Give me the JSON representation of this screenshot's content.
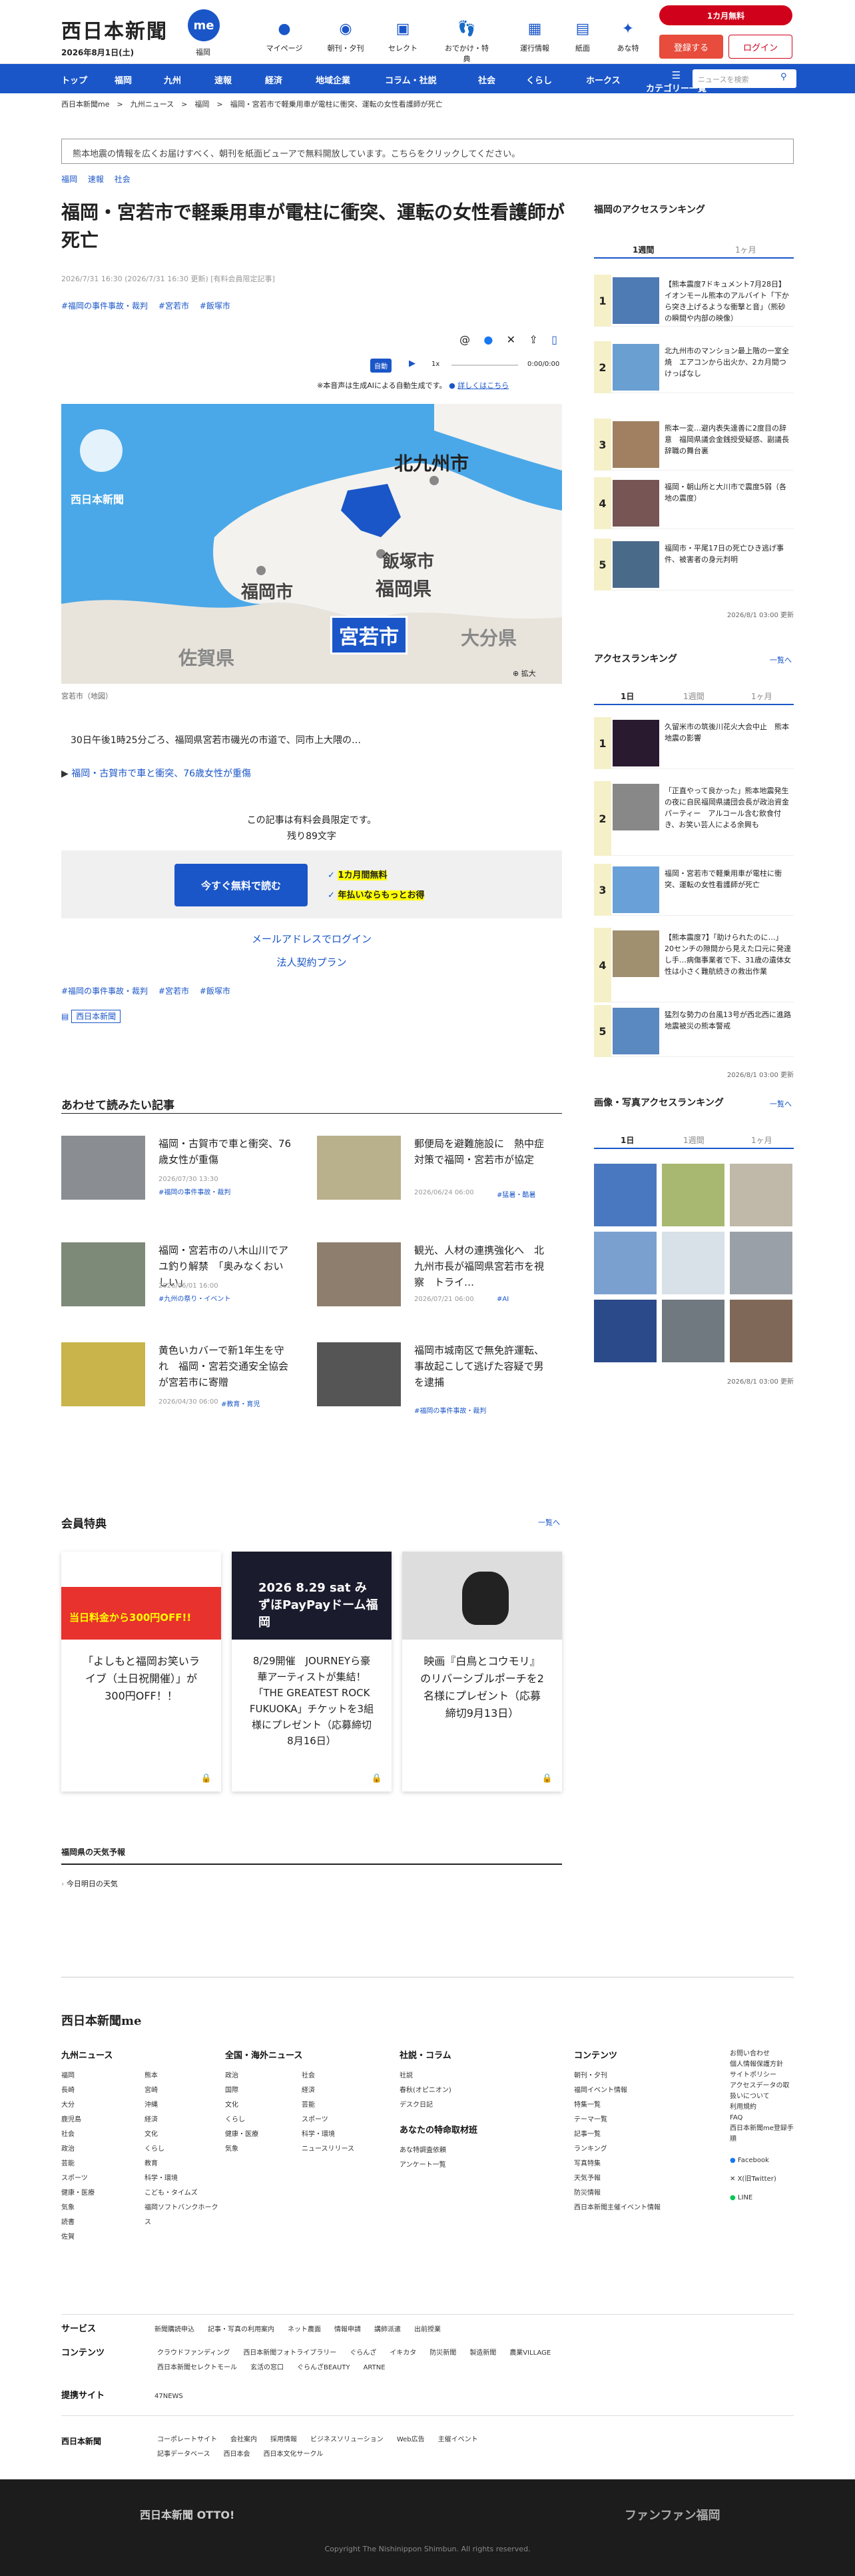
{
  "header": {
    "logo": "西日本新聞",
    "date": "2026年8月1日(土)",
    "me_label": "福岡",
    "me_logo": "me",
    "icons": [
      {
        "label": "マイページ",
        "icon": "me-icon"
      },
      {
        "label": "朝刊・夕刊",
        "icon": "newspaper-icon"
      },
      {
        "label": "セレクト",
        "icon": "select-icon"
      },
      {
        "label": "おでかけ・特典",
        "icon": "footsteps-icon"
      },
      {
        "label": "運行情報",
        "icon": "train-icon"
      },
      {
        "label": "紙面",
        "icon": "paper-icon"
      },
      {
        "label": "あな特",
        "icon": "bee-icon"
      }
    ],
    "promo": "1カ月無料",
    "register": "登録する",
    "login": "ログイン"
  },
  "nav": {
    "items": [
      "トップ",
      "福岡",
      "九州",
      "速報",
      "経済",
      "地域企業",
      "コラム・社説",
      "社会",
      "くらし",
      "ホークス"
    ],
    "more": "カテゴリー一覧",
    "search_placeholder": "ニュースを検索"
  },
  "breadcrumb": "西日本新聞me　>　九州ニュース　>　福岡　>　福岡・宮若市で軽乗用車が電柱に衝突、運転の女性看護師が死亡",
  "banner": "熊本地震の情報を広くお届けすべく、朝刊を紙面ビューアで無料開放しています。こちらをクリックしてください。",
  "article": {
    "tags": [
      "福岡",
      "速報",
      "社会"
    ],
    "title": "福岡・宮若市で軽乗用車が電柱に衝突、運転の女性看護師が死亡",
    "meta": "2026/7/31 16:30 (2026/7/31 16:30 更新) [有料会員限定記事]",
    "hashtags": [
      "#福岡の事件事故・裁判",
      "#宮若市",
      "#飯塚市"
    ],
    "audio": {
      "mode": "自動",
      "speed": "1x",
      "time": "0:00/0:00",
      "note": "※本音声は生成AIによる自動生成です。",
      "link": "詳しくはこちら"
    },
    "map": {
      "labels": [
        "北九州市",
        "飯塚市",
        "福岡県",
        "福岡市",
        "宮若市",
        "佐賀県",
        "大分県"
      ],
      "watermark": "西日本新聞",
      "zoom": "拡大"
    },
    "caption": "宮若市（地図）",
    "lead": "30日午後1時25分ごろ、福岡県宮若市磯光の市道で、同市上大隈の…",
    "related": "福岡・古賀市で車と衝突、76歳女性が重傷",
    "pay_line1": "この記事は有料会員限定です。",
    "pay_line2": "残り89文字",
    "read_btn": "今すぐ無料で読む",
    "check1": "1カ月間無料",
    "check2": "年払いならもっとお得",
    "link_mail": "メールアドレスでログイン",
    "link_corp": "法人契約プラン",
    "tag_box": "西日本新聞"
  },
  "recommend": {
    "title": "あわせて読みたい記事",
    "items": [
      {
        "title": "福岡・古賀市で車と衝突、76歳女性が重傷",
        "date": "2026/07/30 13:30",
        "tag": "#福岡の事件事故・裁判"
      },
      {
        "title": "郵便局を避難施設に　熱中症対策で福岡・宮若市が協定",
        "date": "2026/06/24 06:00",
        "tag": "#猛暑・酷暑"
      },
      {
        "title": "福岡・宮若市の八木山川でアユ釣り解禁　「奥みなくおいしい」",
        "date": "2026/06/01 16:00",
        "tag": "#九州の祭り・イベント"
      },
      {
        "title": "観光、人材の連携強化へ　北九州市長が福岡県宮若市を視察　トライ…",
        "date": "2026/07/21 06:00",
        "tag": "#AI"
      },
      {
        "title": "黄色いカバーで新1年生を守れ　福岡・宮若交通安全協会が宮若市に寄贈",
        "date": "2026/04/30 06:00",
        "tag": "#教育・育児"
      },
      {
        "title": "福岡市城南区で無免許運転、事故起こして逃げた容疑で男を逮捕",
        "date": "2026/06/18 12:00",
        "tag": "#福岡の事件事故・裁判"
      }
    ]
  },
  "benefits": {
    "title": "会員特典",
    "more": "一覧へ",
    "items": [
      {
        "title": "「よしもと福岡お笑いライブ（土日祝開催）」が300円OFF！！",
        "img": "当日料金から300円OFF!!"
      },
      {
        "title": "8/29開催　JOURNEYら豪華アーティストが集結！「THE GREATEST ROCK FUKUOKA」チケットを3組様にプレゼント（応募締切8月16日）",
        "img": "2026 8.29 sat みずほPayPayドーム福岡"
      },
      {
        "title": "映画『白鳥とコウモリ』のリバーシブルポーチを2名様にプレゼント（応募締切9月13日）",
        "img": ""
      }
    ]
  },
  "weather": {
    "title": "福岡県の天気予報",
    "item": "今日明日の天気"
  },
  "sidebar": {
    "access_title": "福岡のアクセスランキング",
    "tabs": [
      "1週間",
      "1ヶ月"
    ],
    "access": [
      "【熊本震度7ドキュメント7月28日】イオンモール熊本のアルバイト「下から突き上げるような衝撃と音」（熊砂の瞬間や内部の映像）",
      "北九州市のマンション最上階の一室全焼　エアコンから出火か、2カ月間つけっぱなし",
      "熊本一変…避内表失達善に2度目の辞意　福岡県議会金銭授受疑惑、副議長辞職の舞台裏",
      "福岡・朝山所と大川市で震度5弱（各地の震度）",
      "福岡市・平尾17日の死亡ひき逃げ事件、被害者の身元判明"
    ],
    "access_updated": "2026/8/1 03:00 更新",
    "ranking_title": "アクセスランキング",
    "more": "一覧へ",
    "rtabs": [
      "1日",
      "1週間",
      "1ヶ月"
    ],
    "ranking": [
      "久留米市の筑後川花火大会中止　熊本地震の影響",
      "「正直やって良かった」熊本地震発生の夜に自民福岡県議団会長が政治資金パーティー　アルコール含む飲食付き、お笑い芸人による余興も",
      "福岡・宮若市で軽乗用車が電柱に衝突、運転の女性看護師が死亡",
      "【熊本震度7】「助けられたのに…」20センチの隙間から見えた口元に発達し手…病傷事業者で下、31歳の遺体女性は小さく難航続きの救出作業",
      "猛烈な勢力の台風13号が西北西に進路　地震被災の熊本警戒"
    ],
    "ranking_updated": "2026/8/1 03:00 更新",
    "photo_title": "画像・写真アクセスランキング",
    "photo_updated": "2026/8/1 03:00 更新"
  },
  "footer": {
    "logo": "西日本新聞me",
    "kyushu": {
      "title": "九州ニュース",
      "items": [
        "福岡",
        "長崎",
        "大分",
        "鹿児島",
        "社会",
        "政治",
        "芸能",
        "スポーツ",
        "健康・医療",
        "気象",
        "読書",
        "佐賀",
        "熊本",
        "宮崎",
        "沖縄",
        "経済",
        "文化",
        "くらし",
        "教育",
        "科学・環境",
        "こども・タイムズ",
        "福岡ソフトバンクホークス"
      ]
    },
    "national": {
      "title": "全国・海外ニュース",
      "items": [
        "政治",
        "国際",
        "文化",
        "くらし",
        "健康・医療",
        "気象",
        "社会",
        "経済",
        "芸能",
        "スポーツ",
        "科学・環境",
        "ニュースリリース"
      ]
    },
    "column": {
      "title": "社説・コラム",
      "items": [
        "社説",
        "春秋(オピニオン)",
        "デスク日記"
      ],
      "sub": "あなたの特命取材班",
      "subitems": [
        "あな特調査依頼",
        "アンケート一覧"
      ]
    },
    "contents": {
      "title": "コンテンツ",
      "items": [
        "朝刊・夕刊",
        "福岡イベント情報",
        "特集一覧",
        "テーマ一覧",
        "記事一覧",
        "ランキング",
        "写真特集",
        "天気予報",
        "防災情報",
        "西日本新聞主催イベント情報"
      ]
    },
    "misc": {
      "items": [
        "お問い合わせ",
        "個人情報保護方針",
        "サイトポリシー",
        "アクセスデータの取扱いについて",
        "利用規約",
        "FAQ",
        "西日本新聞me登録手順"
      ],
      "sns": [
        "Facebook",
        "X(旧Twitter)",
        "LINE"
      ]
    },
    "services": {
      "label": "サービス",
      "items": [
        "新聞購読申込",
        "記事・写真の利用案内",
        "ネット農面",
        "情報申請",
        "講師派遣",
        "出前授業"
      ]
    },
    "contents2": {
      "label": "コンテンツ",
      "items": [
        "クラウドファンディング",
        "西日本新聞フォトライブラリー",
        "ぐらんざ",
        "イキカタ",
        "防災新聞",
        "製造新聞",
        "農業VILLAGE",
        "西日本新聞セレクトモール",
        "玄活の窓口",
        "ぐらんざBEAUTY",
        "ARTNE"
      ]
    },
    "partner": {
      "label": "提携サイト",
      "items": [
        "47NEWS"
      ]
    },
    "corp": {
      "logo": "西日本新聞",
      "items": [
        "コーポレートサイト",
        "会社案内",
        "採用情報",
        "ビジネスソリューション",
        "Web広告",
        "主催イベント",
        "記事データベース",
        "西日本会",
        "西日本文化サークル"
      ]
    },
    "otto": "西日本新聞 OTTO!",
    "fanfan": "ファンファン福岡",
    "copyright": "Copyright The Nishinippon Shimbun. All rights reserved."
  }
}
